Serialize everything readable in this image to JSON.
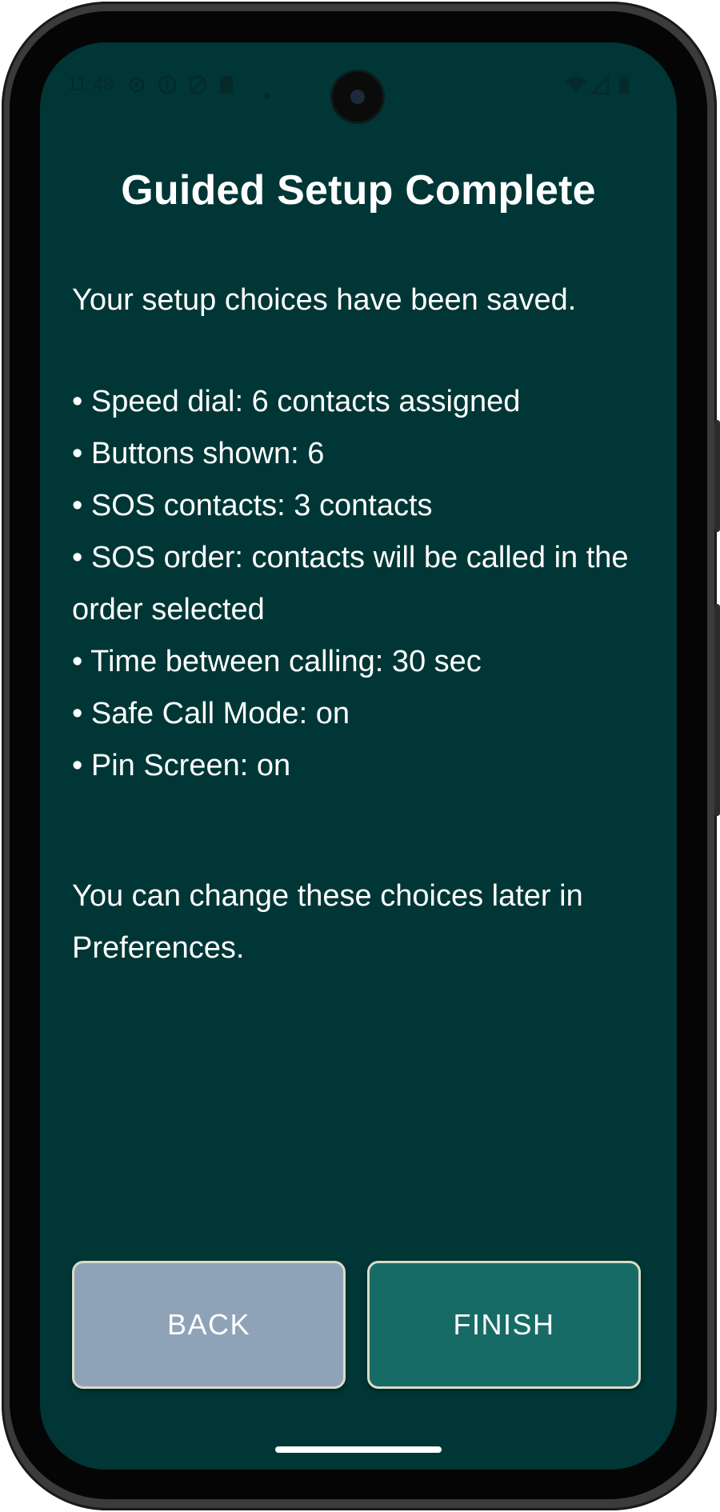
{
  "status_bar": {
    "time": "11:48",
    "left_icons": [
      "settings-icon",
      "info-icon",
      "shield-icon",
      "sd-card-icon",
      "dot-icon"
    ],
    "right_icons": [
      "wifi-icon",
      "signal-icon",
      "battery-icon"
    ]
  },
  "screen": {
    "title": "Guided Setup Complete",
    "intro": "Your setup choices have been saved.",
    "summary": [
      "• Speed dial: 6 contacts assigned",
      "• Buttons shown: 6",
      "• SOS contacts: 3 contacts",
      "• SOS order: contacts will be called in the order selected",
      "• Time between calling: 30 sec",
      "• Safe Call Mode: on",
      "• Pin Screen: on"
    ],
    "outro": "You can change these choices later in Preferences."
  },
  "buttons": {
    "back": "BACK",
    "finish": "FINISH"
  },
  "colors": {
    "background": "#003636",
    "back_button": "#8fa3b8",
    "finish_button": "#166b66",
    "button_border": "#d7dcc6",
    "text": "#ffffff"
  }
}
